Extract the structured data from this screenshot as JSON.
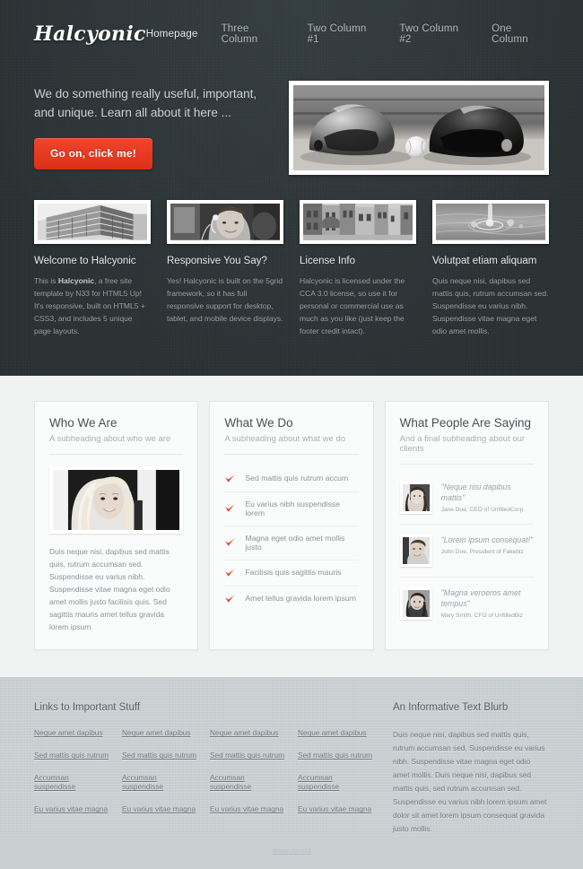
{
  "brand": {
    "logo": "Halcyonic"
  },
  "nav": {
    "items": [
      {
        "label": "Homepage",
        "active": true
      },
      {
        "label": "Three Column",
        "active": false
      },
      {
        "label": "Two Column #1",
        "active": false
      },
      {
        "label": "Two Column #2",
        "active": false
      },
      {
        "label": "One Column",
        "active": false
      }
    ]
  },
  "hero": {
    "headline": "We do something really useful, important, and unique. Learn all about it here ...",
    "button_label": "Go on, click me!",
    "image_name": "baseball-helmets-photo",
    "accent_color": "#e63c22"
  },
  "features": [
    {
      "image_name": "office-building-photo",
      "title": "Welcome to Halcyonic",
      "text_before": "This is ",
      "text_bold": "Halcyonic",
      "text_after": ", a free site template by N33 for HTML5 Up! It's responsive, built on HTML5 + CSS3, and includes 5 unique page layouts."
    },
    {
      "image_name": "man-with-headset-photo",
      "title": "Responsive You Say?",
      "text_before": "",
      "text_bold": "",
      "text_after": "Yes! Halcyonic is built on the 5grid framework, so it has full responsive support for desktop, tablet, and mobile device displays."
    },
    {
      "image_name": "city-street-photo",
      "title": "License Info",
      "text_before": "",
      "text_bold": "",
      "text_after": "Halcyonic is licensed under the CCA 3.0 license, so use it for personal or commercial use as much as you like (just keep the footer credit intact)."
    },
    {
      "image_name": "water-droplet-photo",
      "title": "Volutpat etiam aliquam",
      "text_before": "",
      "text_bold": "",
      "text_after": "Quis neque nisi, dapibus sed mattis quis, rutrum accumsan sed. Suspendisse eu varius nibh. Suspendisse vitae magna eget odio amet mollis."
    }
  ],
  "main": {
    "who_we_are": {
      "title": "Who We Are",
      "subtitle": "A subheading about who we are",
      "image_name": "blonde-woman-portrait-photo",
      "body": "Duis neque nisi, dapibus sed mattis quis, rutrum accumsan sed. Suspendisse eu varius nibh. Suspendisse vitae magna eget odio amet mollis justo facilisis quis. Sed sagittis mauris amet tellus gravida lorem ipsum."
    },
    "what_we_do": {
      "title": "What We Do",
      "subtitle": "A subheading about what we do",
      "check_icon": "check-icon",
      "items": [
        "Sed mattis quis rutrum accum",
        "Eu varius nibh suspendisse lorem",
        "Magna eget odio amet mollis justo",
        "Facilisis quis sagittis mauris",
        "Amet tellus gravida lorem ipsum"
      ]
    },
    "testimonials": {
      "title": "What People Are Saying",
      "subtitle": "And a final subheading about our clients",
      "items": [
        {
          "avatar_name": "avatar-jane-doe",
          "quote": "\"Neque nisi dapibus mattis\"",
          "who": "Jane Doe, CEO of UnfilledCorp"
        },
        {
          "avatar_name": "avatar-john-doe",
          "quote": "\"Lorem ipsum consequat!\"",
          "who": "John Doe, President of Fakebiz"
        },
        {
          "avatar_name": "avatar-mary-smith",
          "quote": "\"Magna veroeros amet tempus\"",
          "who": "Mary Smith, CFO of UnfilledBiz"
        }
      ]
    }
  },
  "footer": {
    "links_title": "Links to Important Stuff",
    "link_columns": [
      [
        "Neque amet dapibus",
        "Sed mattis quis rutrum",
        "Accumsan suspendisse",
        "Eu varius vitae magna"
      ],
      [
        "Neque amet dapibus",
        "Sed mattis quis rutrum",
        "Accumsan suspendisse",
        "Eu varius vitae magna"
      ],
      [
        "Neque amet dapibus",
        "Sed mattis quis rutrum",
        "Accumsan suspendisse",
        "Eu varius vitae magna"
      ],
      [
        "Neque amet dapibus",
        "Sed mattis quis rutrum",
        "Accumsan suspendisse",
        "Eu varius vitae magna"
      ]
    ],
    "blurb_title": "An Informative Text Blurb",
    "blurb_text": "Duis neque nisi, dapibus sed mattis quis, rutrum accumsan sed. Suspendisse eu varius nibh. Suspendisse vitae magna eget odio amet mollis. Duis neque nisi, dapibus sed mattis quis, sed rutrum accumsan sed. Suspendisse eu varius nibh lorem ipsum amet dolor sit amet lorem ipsum consequat gravida justo mollis.",
    "credit": "design by n33"
  }
}
